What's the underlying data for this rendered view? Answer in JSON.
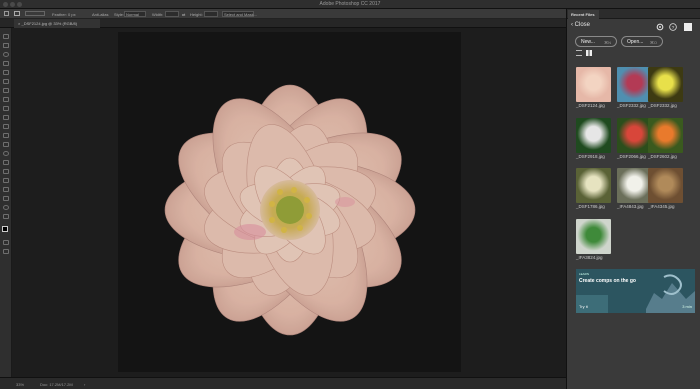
{
  "app": {
    "title": "Adobe Photoshop CC 2017"
  },
  "options_bar": {
    "items": [
      "Feather: 0 px",
      "Anti-alias",
      "Style:",
      "Normal",
      "Width:",
      "Height:",
      "Select and Mask..."
    ]
  },
  "document": {
    "tab_label": "_DSF2124.jpg @ 33% (RGB/8)",
    "zoom": "33%",
    "doc_info": "Doc: 17.2M/17.2M"
  },
  "panel": {
    "tab_label": "Recent Files",
    "close_label": "Close",
    "new_button": {
      "label": "New...",
      "shortcut": "⌘N"
    },
    "open_button": {
      "label": "Open...",
      "shortcut": "⌘O"
    },
    "files": [
      {
        "name": "_DSF2124.jpg",
        "color": "#e6b8a8",
        "accent": "#f3d4c2"
      },
      {
        "name": "_DSF2332.jpg",
        "color": "#4f8fb0",
        "accent": "#b33a55"
      },
      {
        "name": "_DSF2332.jpg",
        "color": "#3d3a12",
        "accent": "#e8e04a"
      },
      {
        "name": "_DSF2918.jpg",
        "color": "#1f4a1f",
        "accent": "#e6e6e6"
      },
      {
        "name": "_DSF2066.jpg",
        "color": "#2c4e1c",
        "accent": "#d8463a"
      },
      {
        "name": "_DSF2602.jpg",
        "color": "#3a5a1e",
        "accent": "#e97a2c"
      },
      {
        "name": "_DSF1786.jpg",
        "color": "#5a6236",
        "accent": "#e6e3c0"
      },
      {
        "name": "_IFA4843.jpg",
        "color": "#6b6f5a",
        "accent": "#f1f1ea"
      },
      {
        "name": "_IFA4345.jpg",
        "color": "#6e4f32",
        "accent": "#b08a5a"
      },
      {
        "name": "_IFA3824.jpg",
        "color": "#cfd5cc",
        "accent": "#3f8a3a"
      }
    ],
    "promo": {
      "tag": "LEARN",
      "headline": "Create comps on the go",
      "cta": "Try it",
      "duration": "3 min"
    }
  },
  "colors": {
    "panel_bg": "#3a3a3a",
    "canvas_bg": "#1d1d1d",
    "promo_bg": "#2c5560"
  }
}
